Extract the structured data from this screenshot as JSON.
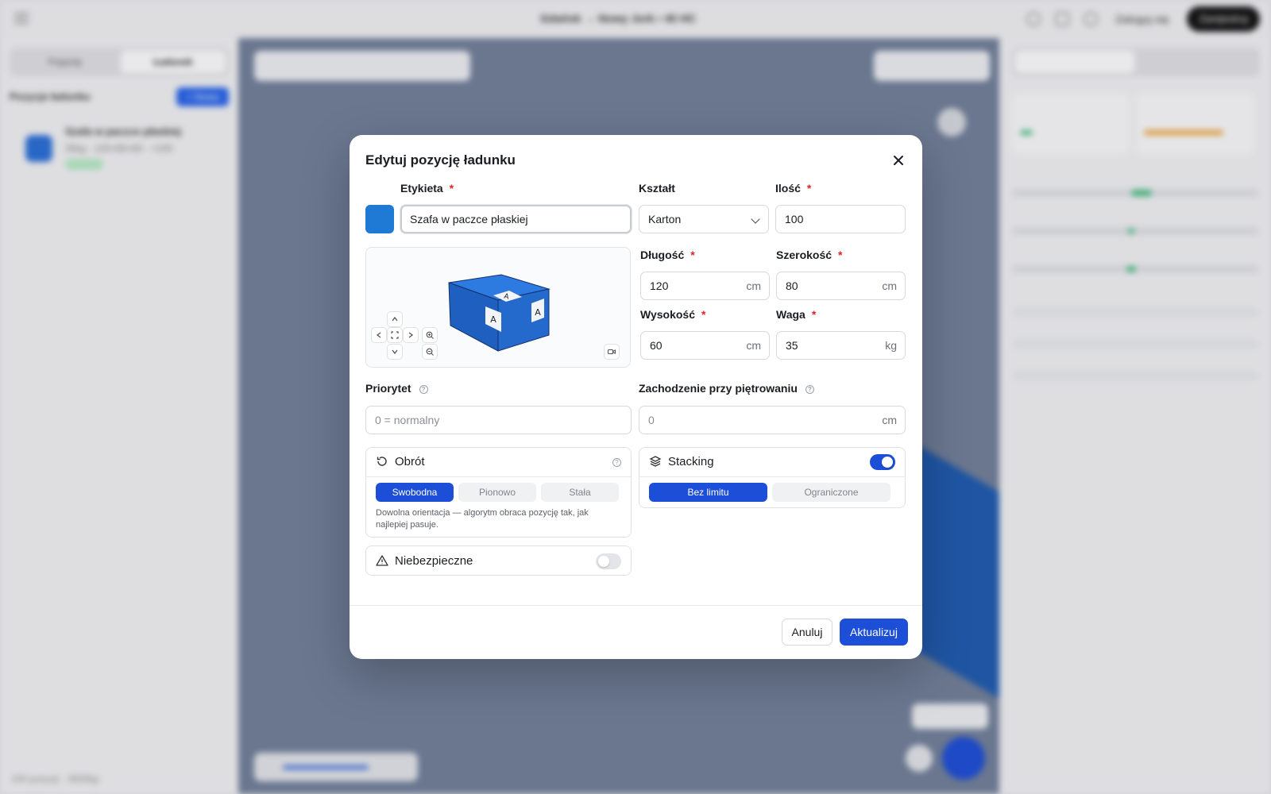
{
  "background": {
    "topbar": {
      "title": "Gdańsk → Nowy Jork • 40 HC",
      "login": "Zaloguj się",
      "signup": "Zarejestruj"
    },
    "left_panel": {
      "tabs": [
        "Pojazdy",
        "Ładunek"
      ],
      "positions_label": "Pozycje ładunku",
      "new_label": "+ Nowa",
      "item_title": "Szafa w paczce płaskiej",
      "item_sub": "35kg · 120×80×60 · ×100",
      "footer": "100 pozycji · 3500kg"
    }
  },
  "modal": {
    "title": "Edytuj pozycję ładunku",
    "swatch_color": "#1f7ad6",
    "label": {
      "title": "Etykieta",
      "value": "Szafa w paczce płaskiej"
    },
    "shape": {
      "title": "Kształt",
      "value": "Karton"
    },
    "quantity": {
      "title": "Ilość",
      "value": "100"
    },
    "length": {
      "title": "Długość",
      "value": "120",
      "unit": "cm"
    },
    "width": {
      "title": "Szerokość",
      "value": "80",
      "unit": "cm"
    },
    "height": {
      "title": "Wysokość",
      "value": "60",
      "unit": "cm"
    },
    "weight": {
      "title": "Waga",
      "value": "35",
      "unit": "kg"
    },
    "priority": {
      "title": "Priorytet",
      "placeholder": "0 = normalny"
    },
    "overhang": {
      "title": "Zachodzenie przy piętrowaniu",
      "placeholder": "0",
      "unit": "cm"
    },
    "rotation": {
      "title": "Obrót",
      "options": [
        "Swobodna",
        "Pionowo",
        "Stała"
      ],
      "selected": "Swobodna",
      "description": "Dowolna orientacja — algorytm obraca pozycję tak, jak najlepiej pasuje."
    },
    "stacking": {
      "title": "Stacking",
      "enabled": true,
      "options": [
        "Bez limitu",
        "Ograniczone"
      ],
      "selected": "Bez limitu"
    },
    "hazardous": {
      "title": "Niebezpieczne",
      "enabled": false
    },
    "cancel_label": "Anuluj",
    "submit_label": "Aktualizuj",
    "accent_color": "#1d4ed8"
  }
}
